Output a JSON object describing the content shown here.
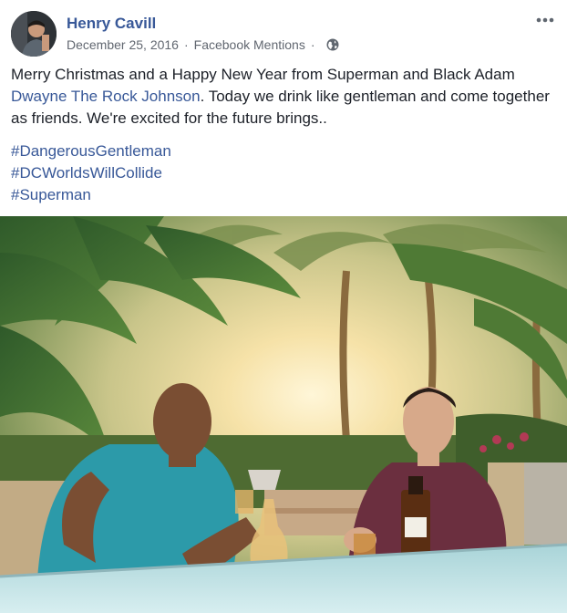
{
  "post": {
    "author": "Henry Cavill",
    "date": "December 25, 2016",
    "separator": "·",
    "source": "Facebook Mentions",
    "privacy_icon": "globe-icon",
    "more_icon": "more-options-icon",
    "message": {
      "text_before": "Merry Christmas and a Happy New Year from Superman and Black Adam ",
      "mention": "Dwayne The Rock Johnson",
      "text_after": ". Today we drink like gentleman and come together as friends. We're excited for the future brings.."
    },
    "hashtags": [
      "#DangerousGentleman",
      "#DCWorldsWillCollide",
      "#Superman"
    ],
    "photo_icon": "post-photo"
  },
  "colors": {
    "link": "#385898",
    "text": "#1d2129",
    "meta": "#616770"
  }
}
